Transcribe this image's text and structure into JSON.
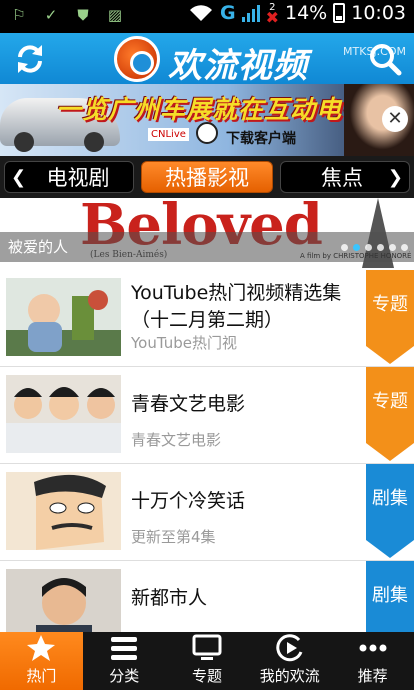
{
  "status_bar": {
    "battery": "14%",
    "time": "10:03",
    "network": "G",
    "notification_count": "2"
  },
  "header": {
    "brand": "欢流视频",
    "watermark": "MTKSJ.COM",
    "colors": {
      "header": "#1a98e0",
      "accent": "#f07a10"
    }
  },
  "ad": {
    "headline": "一览广州车展就在互动电视",
    "cnlive": "CNLive",
    "download": "下载客户端"
  },
  "tabs": {
    "items": [
      "电视剧",
      "热播影视",
      "焦点"
    ],
    "active_index": 1
  },
  "hero": {
    "title_art": "Beloved",
    "subtitle_art": "(Les Bien-Aimés)",
    "credit": "A film by CHRISTOPHE HONORÉ",
    "caption": "被爱的人",
    "page_index": 1,
    "page_count": 6
  },
  "list": [
    {
      "title": "YouTube热门视频精选集（十二月第二期）",
      "subtitle": "YouTube热门视",
      "badge": "专题",
      "badge_color": "orange"
    },
    {
      "title": "青春文艺电影",
      "subtitle": "青春文艺电影",
      "badge": "专题",
      "badge_color": "orange"
    },
    {
      "title": "十万个冷笑话",
      "subtitle": "更新至第4集",
      "badge": "剧集",
      "badge_color": "blue"
    },
    {
      "title": "新都市人",
      "subtitle": "",
      "badge": "剧集",
      "badge_color": "blue"
    }
  ],
  "bottom_nav": {
    "items": [
      {
        "label": "热门",
        "icon": "star-icon"
      },
      {
        "label": "分类",
        "icon": "list-icon"
      },
      {
        "label": "专题",
        "icon": "monitor-icon"
      },
      {
        "label": "我的欢流",
        "icon": "play-circle-icon"
      },
      {
        "label": "推荐",
        "icon": "more-icon"
      }
    ],
    "active_index": 0
  }
}
